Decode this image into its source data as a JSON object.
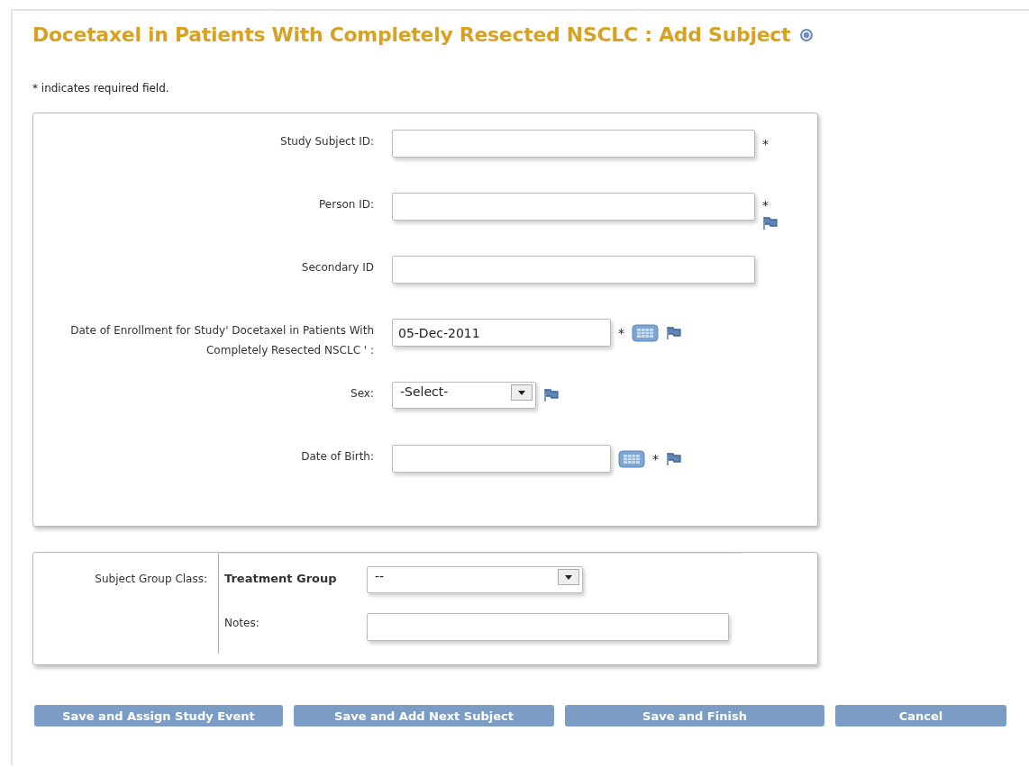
{
  "title": "Docetaxel in Patients With Completely Resected NSCLC : Add Subject",
  "required_note": "* indicates required field.",
  "fields": [
    {
      "label": "Study Subject ID:",
      "kind": "text",
      "extras": [
        {
          "kind": "star",
          "text": "*"
        }
      ]
    },
    {
      "label": "Person ID:",
      "kind": "text",
      "stacked": true,
      "extras": [
        {
          "kind": "star",
          "text": "*"
        },
        {
          "kind": "flag"
        }
      ]
    },
    {
      "label": "Secondary ID",
      "kind": "text"
    },
    {
      "label": "Date of Enrollment for Study' Docetaxel in Patients With Completely Resected NSCLC ' :",
      "kind": "date",
      "value": "05-Dec-2011",
      "extras": [
        {
          "kind": "star",
          "text": "*"
        },
        {
          "kind": "calendar"
        },
        {
          "kind": "flag"
        }
      ]
    },
    {
      "label": "Sex:",
      "kind": "select",
      "value": "-Select-",
      "extras": [
        {
          "kind": "flag"
        }
      ]
    },
    {
      "label": "Date of Birth:",
      "kind": "date",
      "extras": [
        {
          "kind": "calendar"
        },
        {
          "kind": "star",
          "text": "*"
        },
        {
          "kind": "flag"
        }
      ]
    }
  ],
  "group": {
    "label": "Subject Group Class:",
    "name": "Treatment Group",
    "value": "--",
    "notes_label": "Notes:"
  },
  "buttons": [
    "Save and Assign Study Event",
    "Save and Add Next Subject",
    "Save and Finish",
    "Cancel"
  ]
}
